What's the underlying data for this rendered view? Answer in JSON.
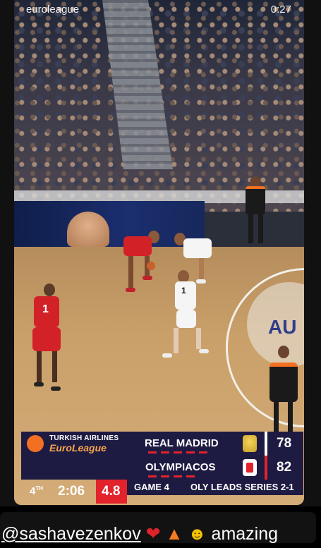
{
  "top_bar": {
    "account": "euroleague",
    "timer": "0:27"
  },
  "scoreboard": {
    "sponsor": "TURKISH AIRLINES",
    "brand": "EuroLeague",
    "home_team": "REAL MADRID",
    "home_score": "78",
    "away_team": "OLYMPIACOS",
    "away_score": "82",
    "quarter": "4",
    "quarter_suffix": "TH",
    "clock": "2:06",
    "shot_clock": "4.8",
    "game": "GAME 4",
    "series": "OLY LEADS SERIES 2-1"
  },
  "jersey_numbers": {
    "red_player": "1",
    "white_player": "1"
  },
  "court_logo": "AU",
  "comment": {
    "mention": "@sashavezenkov",
    "text": "amazing",
    "emojis": [
      "heart-emoji",
      "fire-emoji",
      "winking-face-emoji"
    ]
  }
}
